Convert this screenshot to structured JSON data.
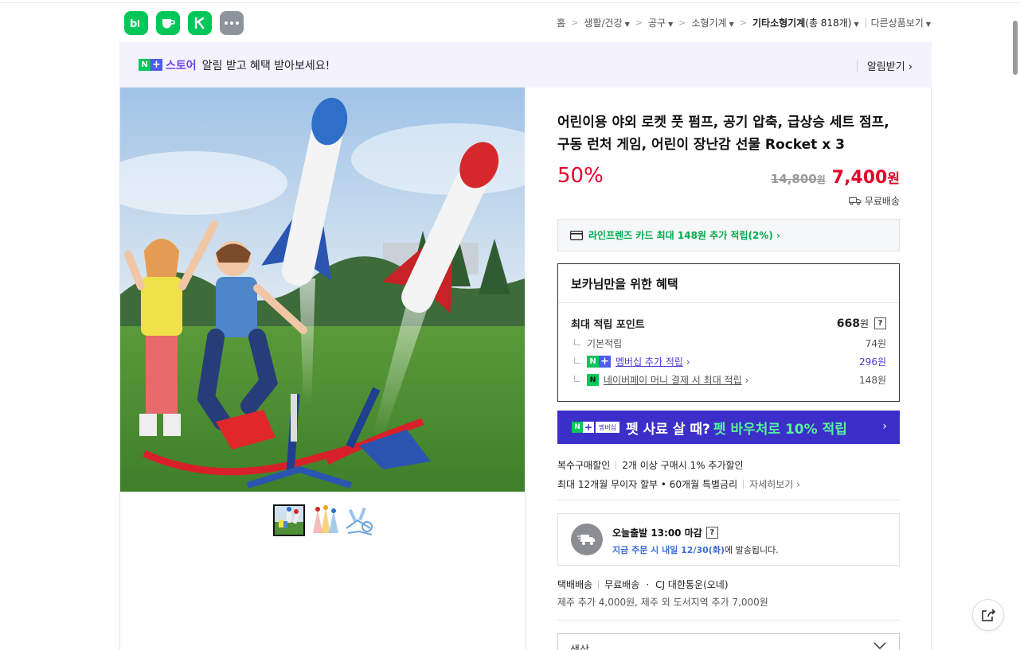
{
  "topbar": {
    "apps": [
      {
        "icon": "blog-icon",
        "label": "b|"
      },
      {
        "icon": "cafe-icon",
        "label": ""
      },
      {
        "icon": "shortcut-icon",
        "label": ""
      },
      {
        "icon": "more-icon",
        "label": "•••"
      }
    ],
    "breadcrumb": {
      "home": "홈",
      "c1": "생활/건강",
      "c2": "공구",
      "c3": "소형기계",
      "c4": "기타소형기계",
      "c4_count": "(총 818개)",
      "other": "다른상품보기"
    }
  },
  "banner": {
    "brand_n": "N",
    "brand_plus": "+",
    "store_label": "스토어",
    "message": "알림 받고 혜택 받아보세요!",
    "alarm_label": "알림받기 ›"
  },
  "product": {
    "title": "어린이용 야외 로켓 풋 펌프, 공기 압축, 급상승 세트 점프, 구동 런처 게임, 어린이 장난감 선물 Rocket x 3",
    "discount": "50%",
    "original_price": "14,800",
    "original_unit": "원",
    "sale_price": "7,400",
    "sale_unit": "원",
    "shipping": "무료배송"
  },
  "card_benefit": "라인프렌즈 카드 최대 148원 추가 적립(2%) ›",
  "benefit_box": {
    "title": "보카님만을 위한 혜택",
    "max_label": "최대 적립 포인트",
    "max_value": "668",
    "max_unit": "원",
    "help": "?",
    "basic_label": "기본적립",
    "basic_value": "74원",
    "membership_label": "멤버십 추가 적립",
    "membership_value": "296원",
    "npay_label": "네이버페이 머니 결제 시 최대 적립",
    "npay_value": "148원"
  },
  "pet_banner": {
    "badge_n": "N",
    "badge_plus": "+",
    "badge_member": "멤버십",
    "text": "펫 사료 살 때?",
    "highlight": "펫 바우처로 10% 적립",
    "arrow": "›"
  },
  "multi_buy": {
    "label": "복수구매할인",
    "value": "2개 이상 구매시 1% 추가할인"
  },
  "installment": {
    "text": "최대 12개월 무이자 할부 • 60개월 특별금리",
    "more": "자세히보기 ›"
  },
  "today_ship": {
    "title": "오늘출발 13:00 마감",
    "help": "?",
    "highlight": "지금 주문 시 내일 12/30(화)",
    "suffix": "에 발송됩니다."
  },
  "delivery": {
    "type": "택배배송",
    "fee": "무료배송",
    "carrier": "CJ 대한통운(오네)",
    "extra": "제주 추가 4,000원, 제주 외 도서지역 추가 7,000원"
  },
  "option_select": {
    "label": "색상"
  }
}
